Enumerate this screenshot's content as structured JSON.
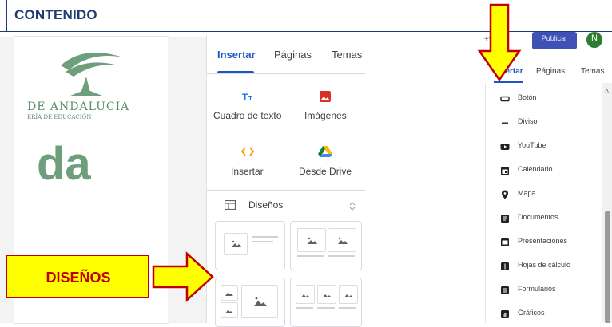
{
  "header": {
    "title": "CONTENIDO"
  },
  "preview": {
    "logo_line1": "DE ANDALUCIA",
    "logo_line2": "ERÍA DE EDUCACIÓN",
    "big_text": "da"
  },
  "middle_panel": {
    "tabs": [
      {
        "label": "Insertar",
        "active": true
      },
      {
        "label": "Páginas",
        "active": false
      },
      {
        "label": "Temas",
        "active": false
      }
    ],
    "tools": [
      {
        "label": "Cuadro de texto",
        "icon": "text-box-icon",
        "color": "#1a73e8"
      },
      {
        "label": "Imágenes",
        "icon": "image-icon",
        "color": "#d93025"
      },
      {
        "label": "Insertar",
        "icon": "embed-code-icon",
        "color": "#f29900"
      },
      {
        "label": "Desde Drive",
        "icon": "google-drive-icon",
        "color": "#188038"
      }
    ],
    "layouts_section": {
      "label": "Diseños",
      "icon": "layouts-icon"
    }
  },
  "top_bar": {
    "publish_label": "Publicar",
    "avatar_letter": "N"
  },
  "right_panel": {
    "tabs": [
      {
        "label": "Insertar",
        "active": true
      },
      {
        "label": "Páginas",
        "active": false
      },
      {
        "label": "Temas",
        "active": false
      }
    ],
    "menu_items": [
      {
        "label": "Botón",
        "icon": "button-icon"
      },
      {
        "label": "Divisor",
        "icon": "divider-icon"
      },
      {
        "label": "YouTube",
        "icon": "youtube-icon"
      },
      {
        "label": "Calendario",
        "icon": "calendar-icon"
      },
      {
        "label": "Mapa",
        "icon": "map-pin-icon"
      },
      {
        "label": "Documentos",
        "icon": "docs-icon"
      },
      {
        "label": "Presentaciones",
        "icon": "slides-icon"
      },
      {
        "label": "Hojas de cálculo",
        "icon": "sheets-icon"
      },
      {
        "label": "Formularios",
        "icon": "forms-icon"
      },
      {
        "label": "Gráficos",
        "icon": "charts-icon"
      }
    ]
  },
  "annotations": {
    "callout_label": "DISEÑOS"
  },
  "colors": {
    "accent_blue": "#1a56c8",
    "annotation_yellow": "#ffff00",
    "annotation_red": "#c00000",
    "title_navy": "#1f3b73"
  }
}
